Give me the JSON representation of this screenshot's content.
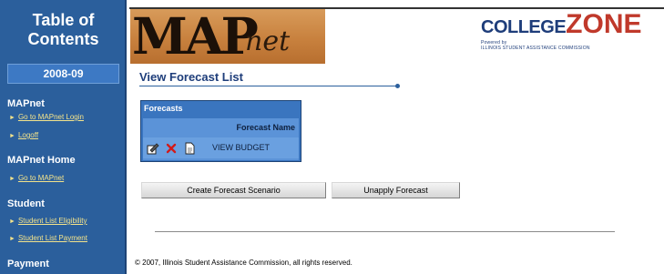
{
  "sidebar": {
    "title": "Table of Contents",
    "year": "2008-09",
    "sections": [
      {
        "heading": "MAPnet",
        "links": [
          "Go to MAPnet Login",
          "Logoff"
        ]
      },
      {
        "heading": "MAPnet Home",
        "links": [
          "Go to MAPnet"
        ]
      },
      {
        "heading": "Student",
        "links": [
          "Student List Eligibility",
          "Student List Payment"
        ]
      },
      {
        "heading": "Payment",
        "links": []
      }
    ]
  },
  "header": {
    "logo_big": "MAP",
    "logo_small": "net",
    "collegezone_college": "COLLEGE",
    "collegezone_zone": "ZONE",
    "collegezone_sub1": "Powered by",
    "collegezone_sub2": "ILLINOIS STUDENT ASSISTANCE COMMISSION"
  },
  "main": {
    "page_title": "View Forecast List",
    "panel_title": "Forecasts",
    "column_header": "Forecast Name",
    "rows": [
      {
        "name": "VIEW BUDGET",
        "icons": [
          "edit-icon",
          "delete-icon",
          "document-icon"
        ]
      }
    ],
    "buttons": {
      "create": "Create Forecast Scenario",
      "unapply": "Unapply Forecast"
    },
    "copyright": "© 2007, Illinois Student Assistance Commission, all rights reserved."
  },
  "colors": {
    "sidebar_bg": "#2b5f9c",
    "link_yellow": "#f3e38b",
    "title_blue": "#1e3d7a",
    "zone_red": "#c0392b",
    "panel_blue": "#3a75bf"
  }
}
